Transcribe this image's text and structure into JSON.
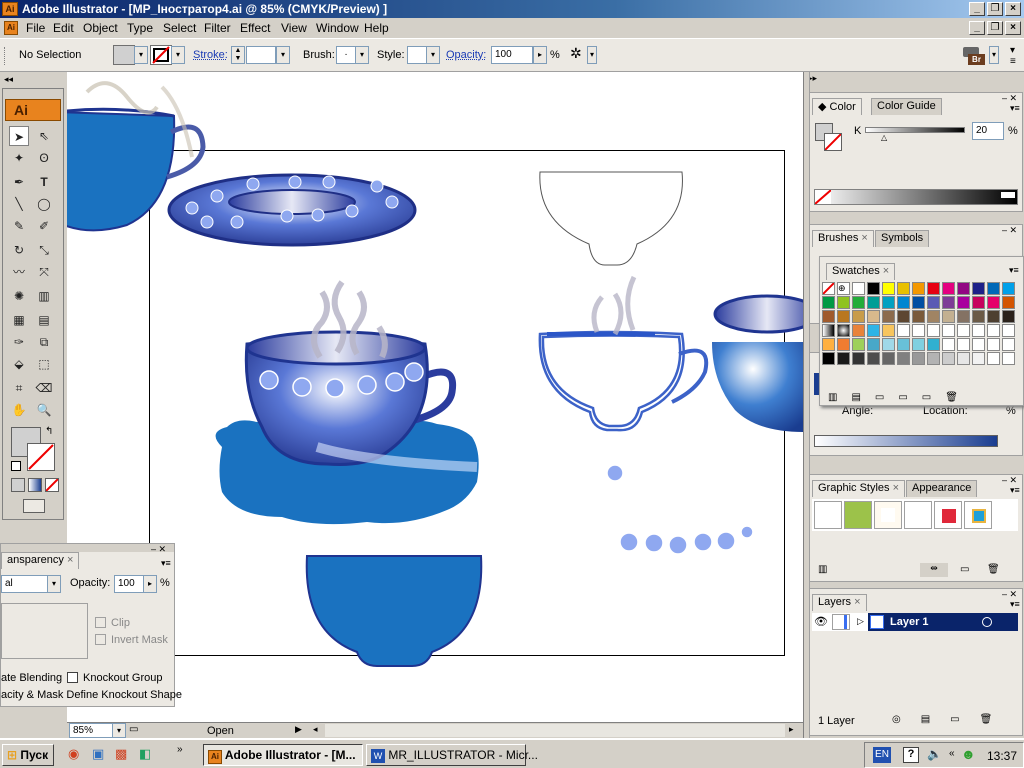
{
  "window": {
    "title": "Adobe Illustrator - [MP_Іностратор4.ai @ 85% (CMYK/Preview) ]",
    "app_badge": "Ai"
  },
  "menu": [
    "File",
    "Edit",
    "Object",
    "Type",
    "Select",
    "Filter",
    "Effect",
    "View",
    "Window",
    "Help"
  ],
  "control_bar": {
    "selection": "No Selection",
    "stroke_label": "Stroke:",
    "brush_label": "Brush:",
    "brush_value": "·",
    "style_label": "Style:",
    "opacity_label": "Opacity:",
    "opacity_value": "100",
    "opacity_unit": "%",
    "bridge_badge": "Br"
  },
  "toolbox": {
    "logo": "Ai"
  },
  "transparency_panel": {
    "tab": "ansparency",
    "mode_value": "al",
    "opacity_label": "Opacity:",
    "opacity_value": "100",
    "opacity_unit": "%",
    "clip_label": "Clip",
    "invert_label": "Invert Mask",
    "isolate_label": "ate Blending",
    "knockout_label": "Knockout Group",
    "opacity_mask_label": "acity & Mask Define Knockout Shape"
  },
  "color_panel": {
    "tabs": [
      "Color",
      "Color Guide"
    ],
    "channel": "K",
    "value": "20",
    "unit": "%"
  },
  "brushes_panel": {
    "tabs": [
      "Brushes",
      "Symbols"
    ]
  },
  "swatches_panel": {
    "tab": "Swatches"
  },
  "gradient_panel": {
    "angle_label": "Angle:",
    "location_label": "Location:",
    "unit": "%"
  },
  "graphic_styles_panel": {
    "tabs": [
      "Graphic Styles",
      "Appearance"
    ]
  },
  "layers_panel": {
    "tab": "Layers",
    "layer_name": "Layer 1",
    "footer": "1 Layer"
  },
  "statusbar": {
    "zoom": "85%",
    "status": "Open"
  },
  "taskbar": {
    "start": "Пуск",
    "tasks": [
      "Adobe Illustrator - [M...",
      "MR_ILLUSTRATOR - Micr..."
    ],
    "lang": "EN",
    "clock": "13:37"
  },
  "colors": {
    "cup_blue": "#1a72c0",
    "deep_blue": "#1f3490",
    "title_bar": "#0a246a",
    "layer_highlight": "#0a246a"
  }
}
